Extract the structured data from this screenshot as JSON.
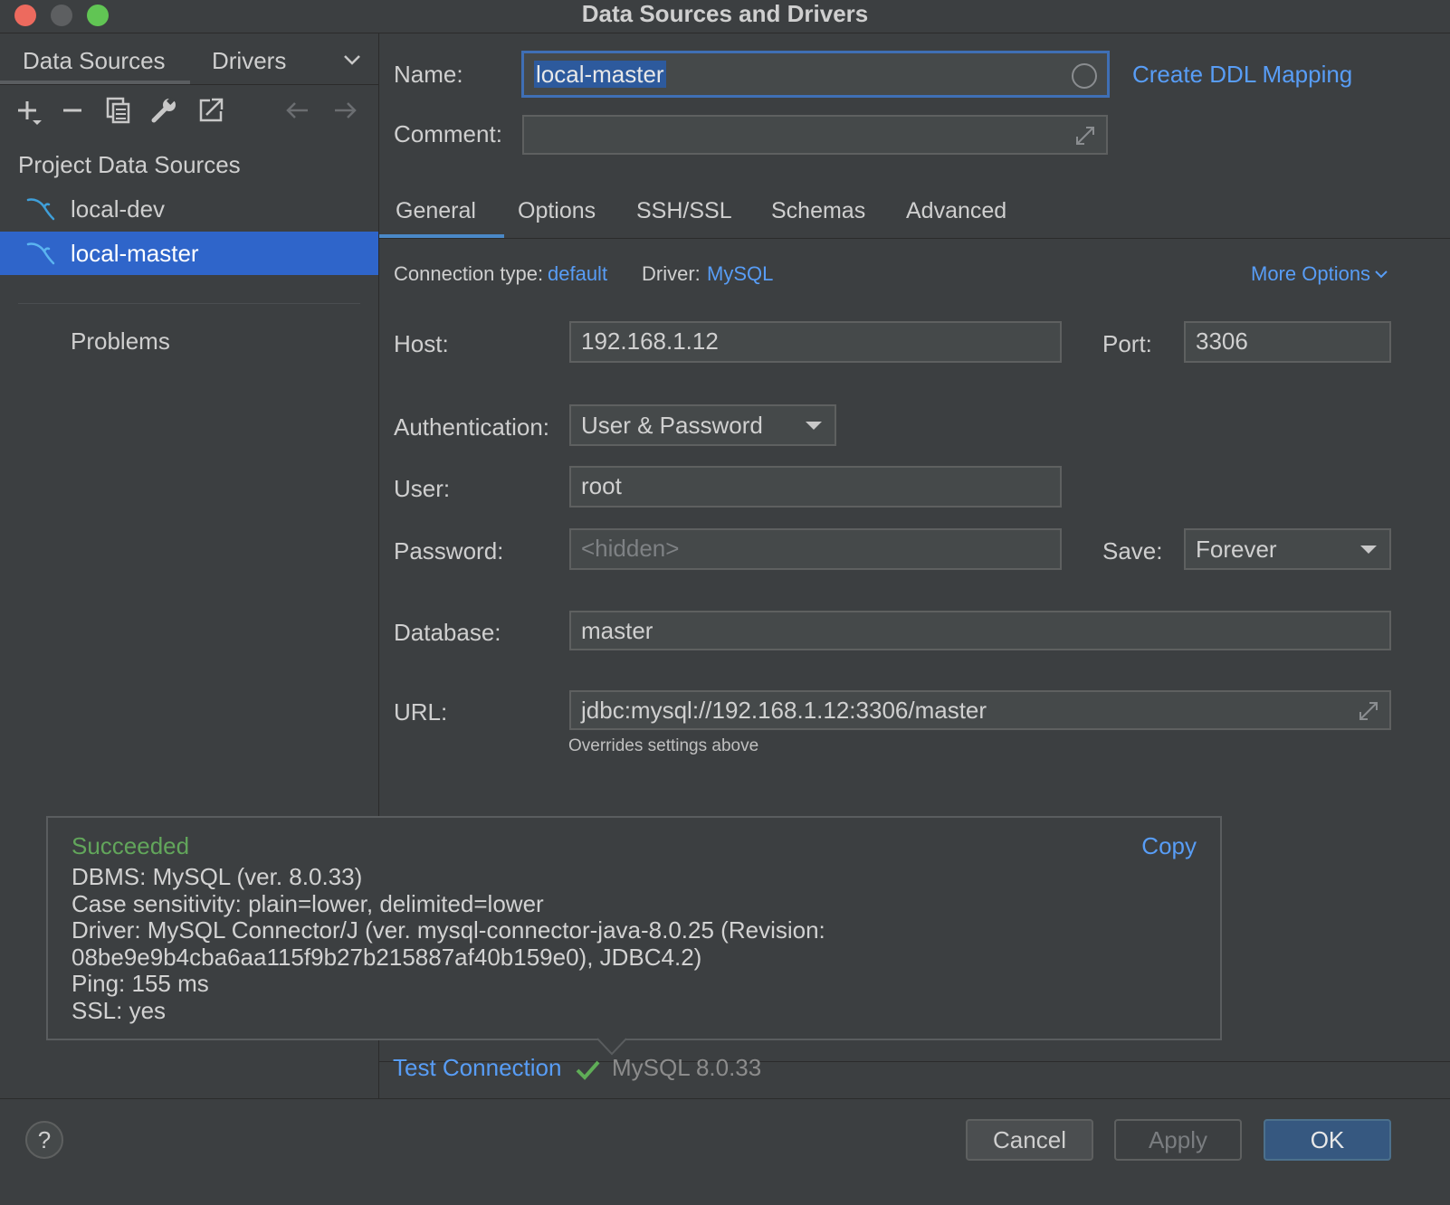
{
  "window": {
    "title": "Data Sources and Drivers"
  },
  "left": {
    "tabs": [
      {
        "label": "Data Sources"
      },
      {
        "label": "Drivers"
      }
    ],
    "section_header": "Project Data Sources",
    "items": [
      {
        "label": "local-dev",
        "icon": "mysql-dolphin-icon",
        "selected": false
      },
      {
        "label": "local-master",
        "icon": "mysql-dolphin-icon",
        "selected": true
      }
    ],
    "problems_label": "Problems"
  },
  "form": {
    "name_label": "Name:",
    "name_value": "local-master",
    "create_ddl_link": "Create DDL Mapping",
    "comment_label": "Comment:",
    "comment_value": "",
    "tabs": [
      {
        "label": "General",
        "active": true
      },
      {
        "label": "Options"
      },
      {
        "label": "SSH/SSL"
      },
      {
        "label": "Schemas"
      },
      {
        "label": "Advanced"
      }
    ],
    "connection_type_label": "Connection type:",
    "connection_type_value": "default",
    "driver_label": "Driver:",
    "driver_value": "MySQL",
    "more_options": "More Options",
    "host_label": "Host:",
    "host_value": "192.168.1.12",
    "port_label": "Port:",
    "port_value": "3306",
    "auth_label": "Authentication:",
    "auth_value": "User & Password",
    "user_label": "User:",
    "user_value": "root",
    "password_label": "Password:",
    "password_placeholder": "<hidden>",
    "save_label": "Save:",
    "save_value": "Forever",
    "database_label": "Database:",
    "database_value": "master",
    "url_label": "URL:",
    "url_value": "jdbc:mysql://192.168.1.12:3306/master",
    "url_hint": "Overrides settings above"
  },
  "test": {
    "link": "Test Connection",
    "result": "MySQL 8.0.33",
    "popup": {
      "status": "Succeeded",
      "copy": "Copy",
      "lines": [
        "DBMS: MySQL (ver. 8.0.33)",
        "Case sensitivity: plain=lower, delimited=lower",
        "Driver: MySQL Connector/J (ver. mysql-connector-java-8.0.25 (Revision:",
        "08be9e9b4cba6aa115f9b27b215887af40b159e0), JDBC4.2)",
        "Ping: 155 ms",
        "SSL: yes"
      ]
    }
  },
  "buttons": {
    "help": "?",
    "cancel": "Cancel",
    "apply": "Apply",
    "ok": "OK"
  },
  "colors": {
    "accent": "#589df6",
    "selection": "#2f65ca",
    "success": "#62a65b",
    "background": "#3c3f41"
  }
}
